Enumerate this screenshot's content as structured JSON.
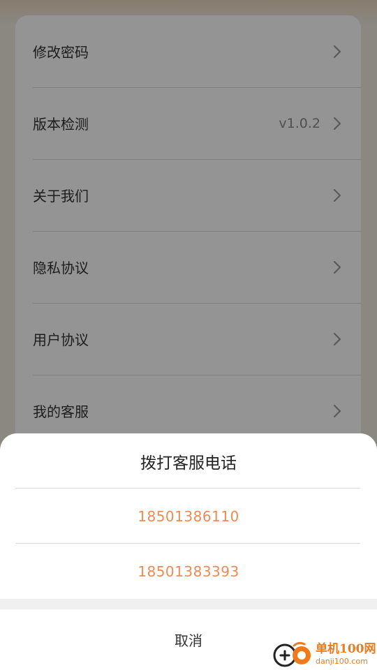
{
  "settings": {
    "items": [
      {
        "label": "修改密码",
        "value": ""
      },
      {
        "label": "版本检测",
        "value": "v1.0.2"
      },
      {
        "label": "关于我们",
        "value": ""
      },
      {
        "label": "隐私协议",
        "value": ""
      },
      {
        "label": "用户协议",
        "value": ""
      },
      {
        "label": "我的客服",
        "value": ""
      }
    ]
  },
  "dialog": {
    "title": "拨打客服电话",
    "phones": [
      "18501386110",
      "18501383393"
    ],
    "cancel_label": "取消"
  },
  "watermark": {
    "main": "单机100网",
    "sub": "danji100.com"
  },
  "colors": {
    "accent": "#f08a55",
    "watermark": "#f07a1a"
  },
  "icons": {
    "row_chevron": "chevron-right-icon"
  }
}
